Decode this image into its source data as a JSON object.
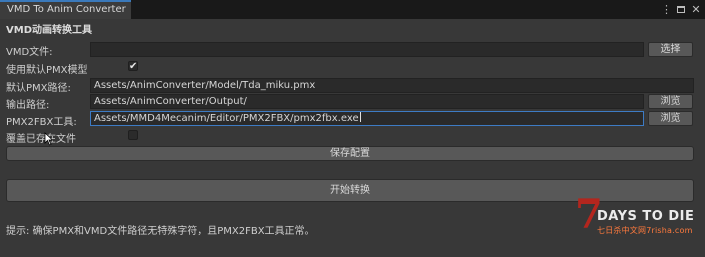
{
  "window": {
    "tab_title": "VMD To Anim Converter",
    "controls": {
      "more_icon": "kebab-menu-icon",
      "maximize_icon": "maximize-icon",
      "close_icon": "close-icon",
      "more_glyph": "⋮",
      "close_glyph": "✕"
    }
  },
  "tool": {
    "heading": "VMD动画转换工具",
    "vmd_file": {
      "label": "VMD文件:",
      "value": "",
      "button": "选择"
    },
    "use_default_pmx": {
      "label": "使用默认PMX模型",
      "checked": true,
      "check_glyph": "✔"
    },
    "default_pmx_path": {
      "label": "默认PMX路径:",
      "value": "Assets/AnimConverter/Model/Tda_miku.pmx"
    },
    "output_path": {
      "label": "输出路径:",
      "value": "Assets/AnimConverter/Output/",
      "button": "浏览"
    },
    "pmx2fbx_tool": {
      "label": "PMX2FBX工具:",
      "value": "Assets/MMD4Mecanim/Editor/PMX2FBX/pmx2fbx.exe",
      "button": "浏览"
    },
    "overwrite_existing": {
      "label": "覆盖已存在文件",
      "checked": false
    },
    "save_config_button": "保存配置",
    "start_convert_button": "开始转换",
    "hint": "提示: 确保PMX和VMD文件路径无特殊字符，且PMX2FBX工具正常。"
  },
  "watermark": {
    "logo_icon": "7-days-to-die-logo",
    "numeral": "7",
    "title": "DAYS TO DIE",
    "subtitle": "七日杀中文网7risha.com"
  },
  "colors": {
    "background": "#383838",
    "field_bg": "#2a2a2a",
    "button_bg": "#585858",
    "focus_border": "#3d7bc4",
    "tab_accent": "#3a79bb",
    "logo_red": "#b3261e",
    "logo_orange": "#ff7a3d"
  }
}
